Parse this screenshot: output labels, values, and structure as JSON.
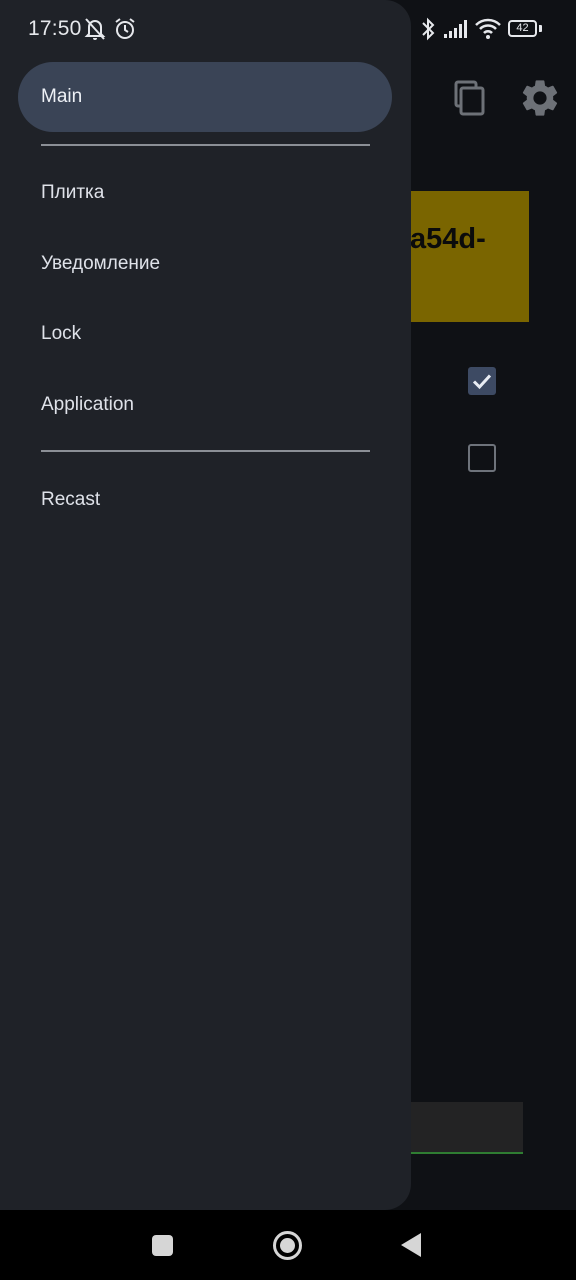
{
  "status_bar": {
    "time": "17:50",
    "battery": "42",
    "icons": [
      "bell-off-icon",
      "alarm-icon",
      "bluetooth-icon",
      "signal-icon",
      "wifi-icon",
      "battery-icon"
    ]
  },
  "app": {
    "card_text": "a54d-",
    "card_color": "#7a6500",
    "checkbox_1_checked": true,
    "checkbox_2_checked": false,
    "actions": [
      "copy-icon",
      "settings-icon"
    ]
  },
  "drawer": {
    "items": [
      {
        "label": "Main",
        "active": true
      },
      {
        "label": "Плитка"
      },
      {
        "label": "Уведомление"
      },
      {
        "label": "Lock"
      },
      {
        "label": "Application"
      },
      {
        "label": "Recast"
      }
    ],
    "active_color": "#3a4456",
    "background_color": "#1f2228"
  },
  "nav_bar": {
    "buttons": [
      "recent-apps",
      "home",
      "back"
    ]
  }
}
